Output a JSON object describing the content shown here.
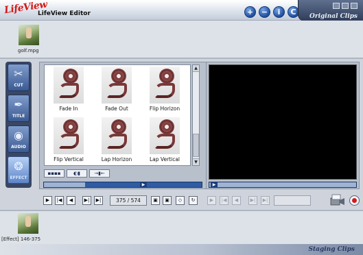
{
  "window": {
    "logo_text": "LifeView",
    "title": "LifeView Editor",
    "panel_title": "Original Clips",
    "round_buttons": [
      "+",
      "−",
      "i",
      "C"
    ]
  },
  "original_clips": {
    "items": [
      {
        "name": "golf.mpg",
        "icon": "golf-thumbnail"
      }
    ]
  },
  "tools": [
    {
      "label": "CUT",
      "icon": "scissors-icon",
      "glyph": "✂",
      "active": false
    },
    {
      "label": "TITLE",
      "icon": "pen-icon",
      "glyph": "✒",
      "active": false
    },
    {
      "label": "AUDIO",
      "icon": "speaker-icon",
      "glyph": "◉",
      "active": false
    },
    {
      "label": "EFFECT",
      "icon": "swirl-icon",
      "glyph": "❂",
      "active": true
    }
  ],
  "effects": {
    "items": [
      {
        "label": "Fade In"
      },
      {
        "label": "Fade Out"
      },
      {
        "label": "Flip Horizon"
      },
      {
        "label": "Flip Vertical"
      },
      {
        "label": "Lap Horizon"
      },
      {
        "label": "Lap Vertical"
      }
    ],
    "toolbar_buttons": [
      {
        "glyph": "▪▪▪▪",
        "icon": "filmstrip-icon"
      },
      {
        "glyph": "◐▮",
        "icon": "reel-icon"
      },
      {
        "glyph": "→▮←",
        "icon": "trim-icon"
      }
    ]
  },
  "transport": {
    "counter": "375 / 574",
    "left_buttons": [
      "▶",
      "|◀",
      "◀",
      "▶|",
      "▶|"
    ],
    "mid_buttons": [
      "▣",
      "▣",
      "◇",
      "↻"
    ]
  },
  "staging": {
    "title": "Staging Clips",
    "items": [
      {
        "label": "[Effect] 146-375",
        "icon": "golf-thumbnail"
      }
    ]
  },
  "colors": {
    "accent": "#2f5ca3",
    "logo": "#d21a1a",
    "record": "#d21a1a"
  }
}
